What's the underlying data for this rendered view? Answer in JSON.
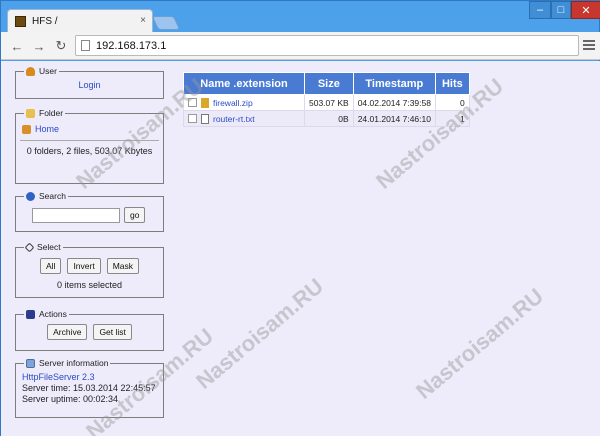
{
  "browser": {
    "tab_title": "HFS /",
    "tab_close": "×",
    "url": "192.168.173.1",
    "back_glyph": "←",
    "forward_glyph": "→",
    "reload_glyph": "↻",
    "min_glyph": "–",
    "max_glyph": "□",
    "close_glyph": "✕"
  },
  "user": {
    "legend": "User",
    "login_label": "Login"
  },
  "folder": {
    "legend": "Folder",
    "home_label": "Home",
    "summary": "0 folders, 2 files, 503.07 Kbytes"
  },
  "search": {
    "legend": "Search",
    "input_value": "",
    "go_label": "go"
  },
  "select": {
    "legend": "Select",
    "all_label": "All",
    "invert_label": "Invert",
    "mask_label": "Mask",
    "status": "0 items selected"
  },
  "actions": {
    "legend": "Actions",
    "archive_label": "Archive",
    "getlist_label": "Get list"
  },
  "server": {
    "legend": "Server information",
    "name": "HttpFileServer 2.3",
    "time": "Server time: 15.03.2014 22:45:57",
    "uptime": "Server uptime: 00:02:34"
  },
  "table": {
    "headers": [
      "Name .extension",
      "Size",
      "Timestamp",
      "Hits"
    ],
    "rows": [
      {
        "name": "firewall.zip",
        "size": "503.07 KB",
        "timestamp": "04.02.2014 7:39:58",
        "hits": "0",
        "icon": "zip-file-icon"
      },
      {
        "name": "router-rt.txt",
        "size": "0B",
        "timestamp": "24.01.2014 7:46:10",
        "hits": "1",
        "icon": "text-file-icon"
      }
    ]
  },
  "watermark": "Nastroisam.RU",
  "colors": {
    "header_blue": "#4a7bd3",
    "page_bg": "#eeebfa",
    "link": "#2a4cc9"
  }
}
